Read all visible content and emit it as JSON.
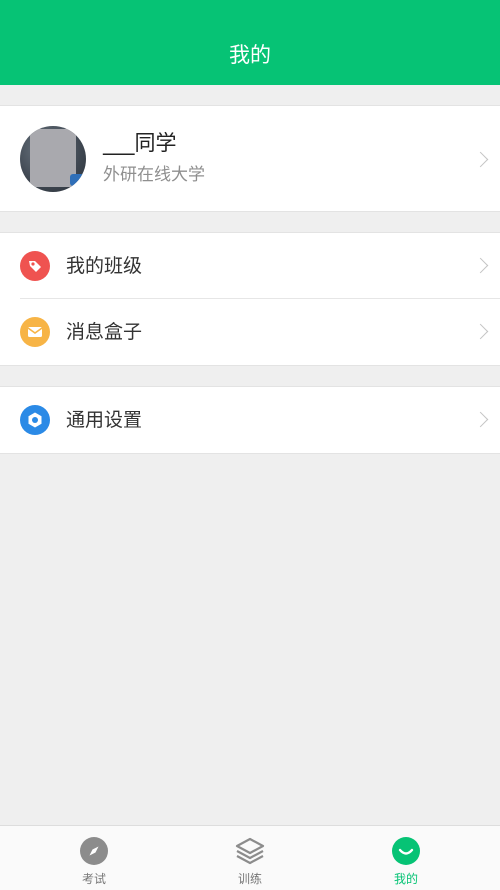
{
  "header": {
    "title": "我的"
  },
  "profile": {
    "name": "___同学",
    "organization": "外研在线大学"
  },
  "menu": {
    "items": [
      {
        "label": "我的班级",
        "icon": "tag-icon"
      },
      {
        "label": "消息盒子",
        "icon": "mail-icon"
      },
      {
        "label": "通用设置",
        "icon": "settings-icon"
      }
    ]
  },
  "tabs": [
    {
      "label": "考试",
      "icon": "compass-icon",
      "active": false
    },
    {
      "label": "训练",
      "icon": "layers-icon",
      "active": false
    },
    {
      "label": "我的",
      "icon": "user-smile-icon",
      "active": true
    }
  ],
  "colors": {
    "brand": "#06c375",
    "background": "#efefef",
    "class_icon": "#ef5350",
    "message_icon": "#f7b446",
    "settings_icon": "#2b8ae6"
  }
}
